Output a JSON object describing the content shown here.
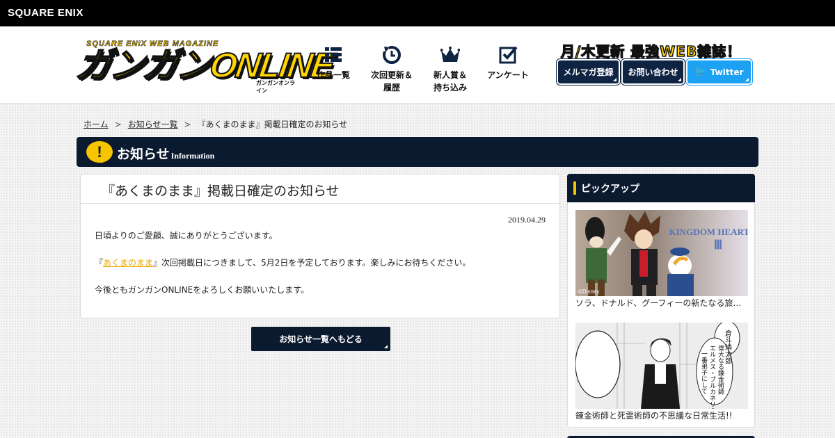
{
  "topbar": {
    "brand": "SQUARE ENIX"
  },
  "header": {
    "logo": {
      "sub": "SQUARE ENIX WEB MAGAZINE",
      "main": "ガンガンONLINE",
      "kana": "ガンガンオンライン"
    },
    "nav": [
      {
        "label": "作品一覧",
        "icon": "grid-list-icon"
      },
      {
        "label": "次回更新＆\n履歴",
        "icon": "refresh-clock-icon"
      },
      {
        "label": "新人賞＆\n持ち込み",
        "icon": "crown-icon"
      },
      {
        "label": "アンケート",
        "icon": "checkbox-icon"
      }
    ],
    "tagline": "月/木更新 最強WEB雑誌！",
    "buttons": {
      "mailmag": "メルマガ登録",
      "contact": "お問い合わせ",
      "twitter": "Twitter"
    }
  },
  "breadcrumb": {
    "home": "ホーム",
    "sep": ">",
    "news": "お知らせ一覧",
    "current": "『あくまのまま』掲載日確定のお知らせ"
  },
  "section": {
    "title": "お知らせ",
    "title_en": "Information",
    "icon": "exclamation-icon"
  },
  "article": {
    "title": "『あくまのまま』掲載日確定のお知らせ",
    "date": "2019.04.29",
    "p1": "日頃よりのご愛顧、誠にありがとうございます。",
    "p2_open": "『",
    "p2_link": "あくまのまま",
    "p2_rest": "』次回掲載日につきまして、5月2日を予定しております。楽しみにお待ちください。",
    "p3": "今後ともガンガンONLINEをよろしくお願いいたします。"
  },
  "back_button": "お知らせ一覧へもどる",
  "sidebar": {
    "heading": "ピックアップ",
    "items": [
      {
        "caption": "ソラ、ドナルド、グーフィーの新たなる旅…",
        "logo_text": "KINGDOM HEARTS",
        "credit": "©Disney"
      },
      {
        "caption": "錬金術師と死霊術師の不思議な日常生活!!",
        "bubble1": "倉斗燐太郎",
        "bubble2": "偉大なる錬金術師\nエルメス・ブルカネリの\n一番弟子にして"
      }
    ]
  },
  "colors": {
    "navy": "#0c1a30",
    "accent_yellow": "#f6c400",
    "twitter": "#1da1f2",
    "link": "#e8a700"
  }
}
